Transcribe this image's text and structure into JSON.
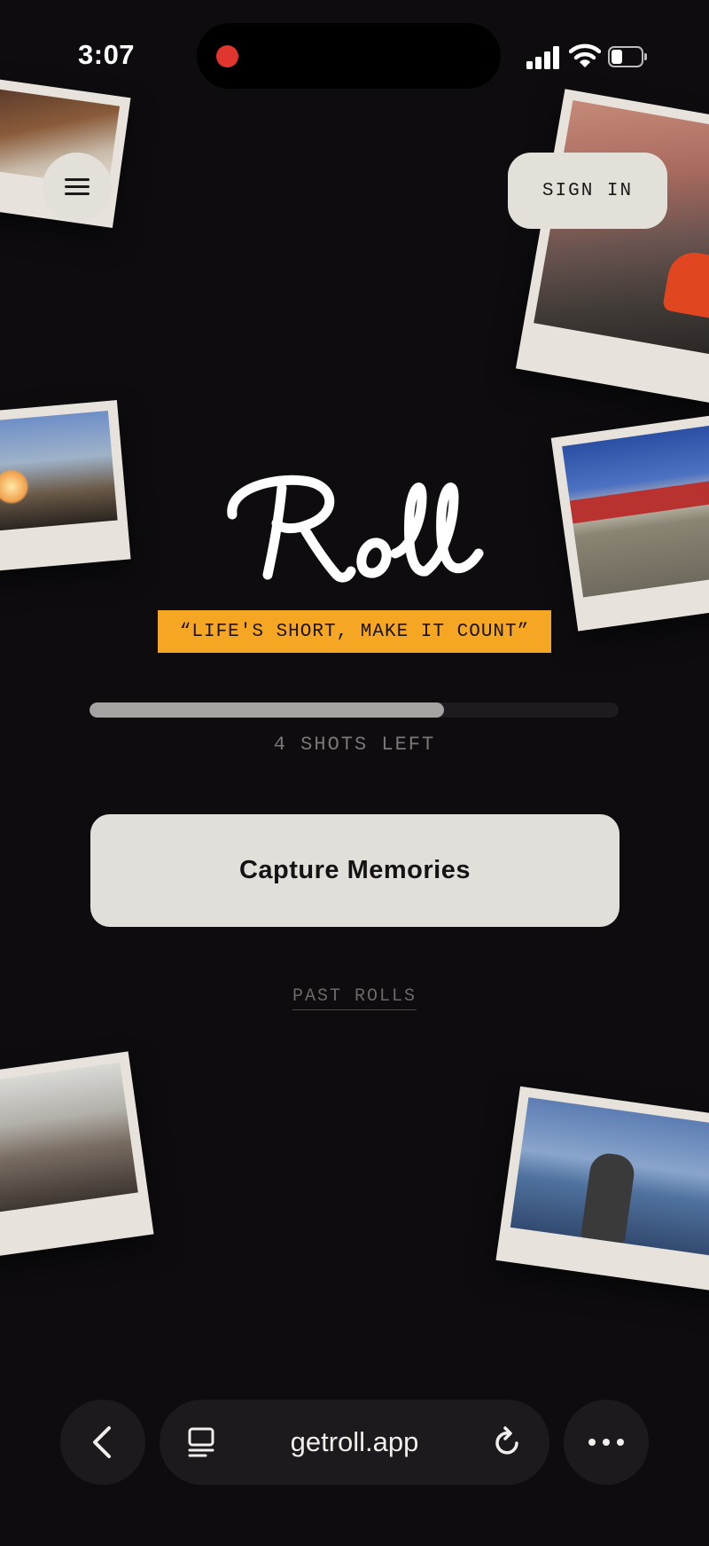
{
  "status_bar": {
    "time": "3:07",
    "recording": true,
    "battery_fraction": 0.4
  },
  "header": {
    "sign_in_label": "SIGN IN",
    "menu_icon": "hamburger-menu-icon"
  },
  "hero": {
    "logo_text": "Roll",
    "tagline": "“LIFE'S SHORT, MAKE IT COUNT”",
    "tagline_bg": "#f5a623"
  },
  "roll": {
    "progress_fraction": 0.67,
    "shots_left_label": "4 SHOTS LEFT"
  },
  "actions": {
    "capture_label": "Capture Memories",
    "past_rolls_label": "PAST ROLLS"
  },
  "browser": {
    "url": "getroll.app",
    "back_icon": "chevron-left-icon",
    "tabs_icon": "tabs-icon",
    "reload_icon": "reload-icon",
    "more_icon": "more-horizontal-icon"
  },
  "colors": {
    "background": "#0e0c0f",
    "button": "#e2dfda",
    "accent": "#f5a623"
  }
}
